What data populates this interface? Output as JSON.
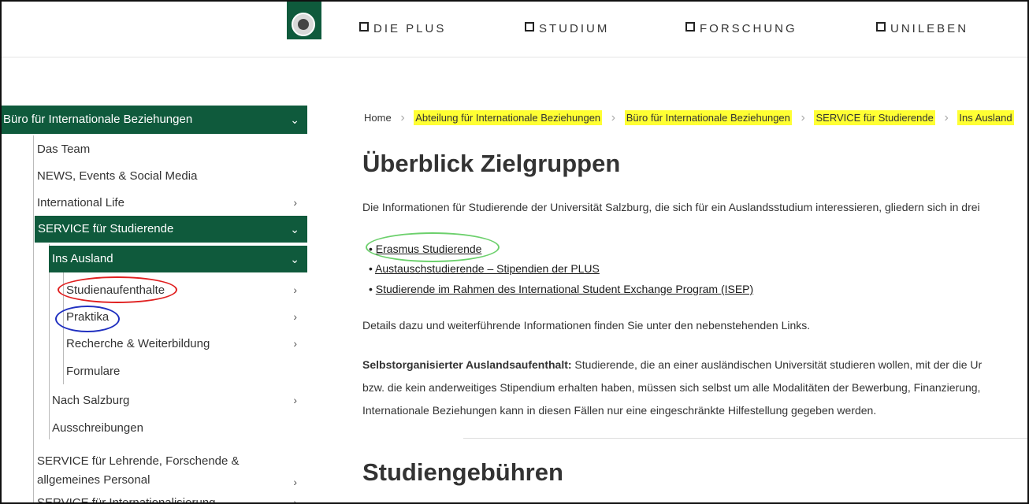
{
  "topnav": {
    "items": [
      "DIE PLUS",
      "STUDIUM",
      "FORSCHUNG",
      "UNILEBEN"
    ]
  },
  "sidebar": {
    "items": [
      {
        "label": "Büro für Internationale Beziehungen",
        "chevron": "⌄"
      },
      {
        "label": "Das Team"
      },
      {
        "label": "NEWS, Events & Social Media"
      },
      {
        "label": "International Life",
        "chevron": "›"
      },
      {
        "label": "SERVICE für Studierende",
        "chevron": "⌄"
      },
      {
        "label": "Ins Ausland",
        "chevron": "⌄"
      },
      {
        "label": "Studienaufenthalte",
        "chevron": "›"
      },
      {
        "label": "Praktika",
        "chevron": "›"
      },
      {
        "label": "Recherche & Weiterbildung",
        "chevron": "›"
      },
      {
        "label": "Formulare"
      },
      {
        "label": "Nach Salzburg",
        "chevron": "›"
      },
      {
        "label": "Ausschreibungen"
      },
      {
        "label": "SERVICE für Lehrende, Forschende &",
        "label2": "allgemeines Personal",
        "chevron": "›"
      },
      {
        "label": "SERVICE für Internationalisierung",
        "chevron": "›"
      }
    ]
  },
  "breadcrumb": {
    "home": "Home",
    "items": [
      "Abteilung für Internationale Beziehungen",
      "Büro für Internationale Beziehungen",
      "SERVICE für Studierende",
      "Ins Ausland"
    ]
  },
  "main": {
    "title": "Überblick Zielgruppen",
    "intro": "Die Informationen für Studierende der Universität Salzburg, die sich für ein Auslandsstudium interessieren, gliedern sich in drei",
    "links": [
      "Erasmus Studierende",
      "Austauschstudierende – Stipendien der PLUS",
      "Studierende im Rahmen des International Student Exchange Program (ISEP)"
    ],
    "details": "Details dazu und weiterführende Informationen finden Sie unter den nebenstehenden Links.",
    "self_bold": "Selbstorganisierter Auslandsaufenthalt:",
    "self_text1": " Studierende, die an einer ausländischen Universität studieren wollen, mit der die Ur",
    "self_text2": "bzw. die kein anderweitiges Stipendium erhalten haben, müssen sich selbst um alle Modalitäten der Bewerbung, Finanzierung,",
    "self_text3": "Internationale Beziehungen kann in diesen Fällen nur eine eingeschränkte Hilfestellung gegeben werden.",
    "section2_title": "Studiengebühren"
  },
  "colors": {
    "brand_green": "#0f5a3c",
    "highlight": "#ffff33",
    "annot_red": "#e02020",
    "annot_blue": "#2030c0",
    "annot_green": "#6cd06c"
  },
  "icons": {
    "logo": "university-seal-icon",
    "nav_bullet": "square-icon",
    "chevron_down": "chevron-down-icon",
    "chevron_right": "chevron-right-icon"
  }
}
